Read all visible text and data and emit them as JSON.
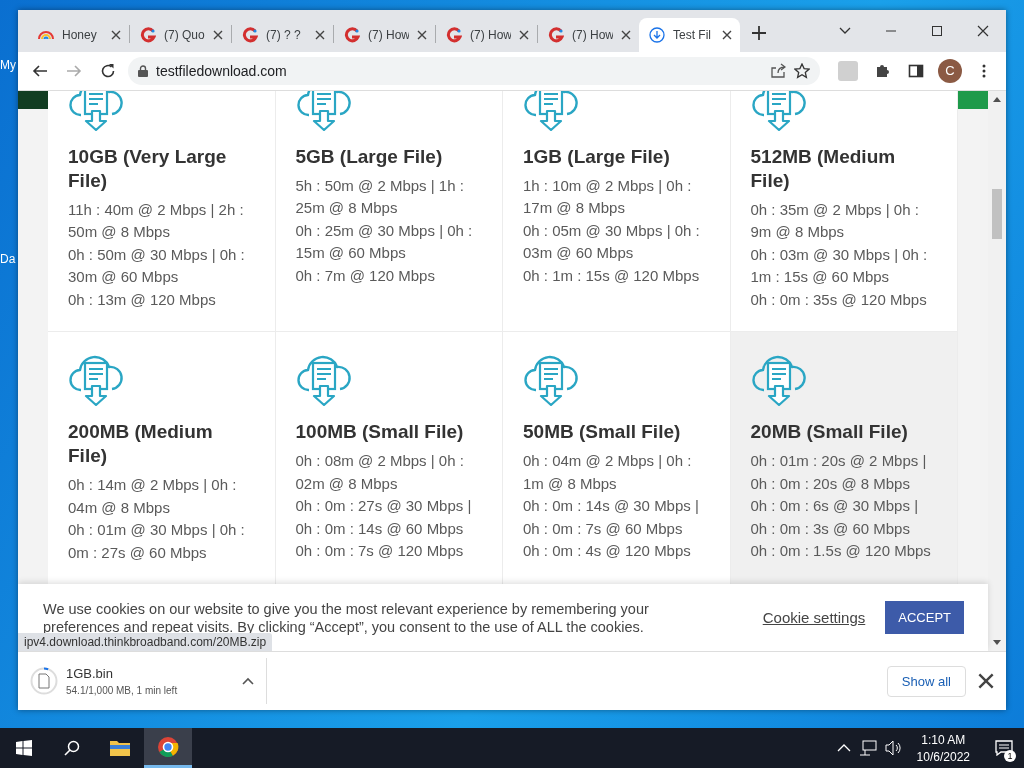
{
  "desktop": {
    "labels": [
      "My",
      "Da"
    ]
  },
  "browser": {
    "tabs": [
      {
        "title": "Honey",
        "kind": "rainbow",
        "selected": false
      },
      {
        "title": "(7) Quo",
        "kind": "letter",
        "selected": false
      },
      {
        "title": "(7) ? ?",
        "kind": "letter",
        "selected": false
      },
      {
        "title": "(7) How",
        "kind": "letter",
        "selected": false
      },
      {
        "title": "(7) How",
        "kind": "letter",
        "selected": false
      },
      {
        "title": "(7) How",
        "kind": "letter",
        "selected": false
      },
      {
        "title": "Test Fil",
        "kind": "download",
        "selected": true
      }
    ],
    "address": "testfiledownload.com",
    "profile_initial": "C"
  },
  "page": {
    "cards": [
      {
        "title": "10GB (Very Large File)",
        "speeds": [
          "11h : 40m @ 2 Mbps | 2h : 50m @ 8 Mbps",
          "0h : 50m @ 30 Mbps | 0h : 30m @ 60 Mbps",
          "0h : 13m @ 120 Mbps"
        ],
        "hovered": false
      },
      {
        "title": "5GB (Large File)",
        "speeds": [
          "5h : 50m @ 2 Mbps | 1h : 25m @ 8 Mbps",
          "0h : 25m @ 30 Mbps | 0h : 15m @ 60 Mbps",
          "0h : 7m @ 120 Mbps"
        ],
        "hovered": false
      },
      {
        "title": "1GB (Large File)",
        "speeds": [
          "1h : 10m @ 2 Mbps | 0h : 17m @ 8 Mbps",
          "0h : 05m @ 30 Mbps | 0h : 03m @ 60 Mbps",
          "0h : 1m : 15s @ 120 Mbps"
        ],
        "hovered": false
      },
      {
        "title": "512MB (Medium File)",
        "speeds": [
          "0h : 35m @ 2 Mbps | 0h : 9m @ 8 Mbps",
          "0h : 03m @ 30 Mbps | 0h : 1m : 15s @ 60 Mbps",
          "0h : 0m : 35s @ 120 Mbps"
        ],
        "hovered": false
      },
      {
        "title": "200MB (Medium File)",
        "speeds": [
          "0h : 14m @ 2 Mbps | 0h : 04m @ 8 Mbps",
          "0h : 01m @ 30 Mbps | 0h : 0m : 27s @ 60 Mbps"
        ],
        "hovered": false
      },
      {
        "title": "100MB (Small File)",
        "speeds": [
          "0h : 08m @ 2 Mbps | 0h : 02m @ 8 Mbps",
          "0h : 0m : 27s @ 30 Mbps | 0h : 0m : 14s @ 60 Mbps",
          "0h : 0m : 7s @ 120 Mbps"
        ],
        "hovered": false
      },
      {
        "title": "50MB (Small File)",
        "speeds": [
          "0h : 04m @ 2 Mbps | 0h : 1m @ 8 Mbps",
          "0h : 0m : 14s @ 30 Mbps | 0h : 0m : 7s @ 60 Mbps",
          "0h : 0m : 4s @ 120 Mbps"
        ],
        "hovered": false
      },
      {
        "title": "20MB (Small File)",
        "speeds": [
          "0h : 01m : 20s @ 2 Mbps | 0h : 0m : 20s @ 8 Mbps",
          "0h : 0m : 6s @ 30 Mbps | 0h : 0m : 3s @ 60 Mbps",
          "0h : 0m : 1.5s @ 120 Mbps"
        ],
        "hovered": true
      }
    ],
    "cookie_banner": {
      "text": "We use cookies on our website to give you the most relevant experience by remembering your preferences and repeat visits. By clicking “Accept”, you consent to the use of ALL the cookies.",
      "settings_link": "Cookie settings",
      "accept_button": "ACCEPT"
    }
  },
  "status_bubble": "ipv4.download.thinkbroadband.com/20MB.zip",
  "downloads": {
    "items": [
      {
        "name": "1GB.bin",
        "progress_text": "54.1/1,000 MB, 1 min left",
        "level": 0.054
      }
    ],
    "show_all": "Show all"
  },
  "taskbar": {
    "apps": [
      {
        "kind": "folder",
        "selected": false
      },
      {
        "kind": "chrome",
        "selected": true
      }
    ],
    "time": "1:10 AM",
    "date": "10/6/2022",
    "notification_count": "1"
  }
}
